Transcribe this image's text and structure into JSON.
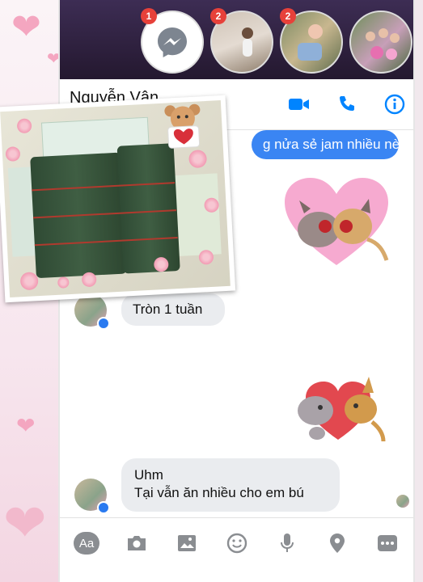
{
  "colors": {
    "messenger_blue": "#3a85f3",
    "badge_red": "#e7413a",
    "incoming_bubble": "#eaecef",
    "icon_gray": "#8a8d91",
    "heart_pink": "#f4a6c0"
  },
  "chat_heads": [
    {
      "name": "messenger-chathead",
      "badge": "1",
      "icon": "messenger-bolt-icon"
    },
    {
      "name": "contact-chathead-1",
      "badge": "2"
    },
    {
      "name": "contact-chathead-2",
      "badge": "2"
    },
    {
      "name": "contact-chathead-3",
      "badge": ""
    }
  ],
  "header": {
    "contact_name": "Nguyễn Vân",
    "icons": [
      "video-call-icon",
      "phone-call-icon",
      "info-icon"
    ]
  },
  "messages": {
    "outgoing_1": "g nửa sẻ jam nhiều nè",
    "incoming_1": "Tròn 1 tuần",
    "incoming_2_line1": "Uhm",
    "incoming_2_line2": "Tại vẫn ăn nhiều cho em bú"
  },
  "stickers": [
    "kissing-cats-sticker",
    "hugging-cats-sticker"
  ],
  "composer": {
    "aa_label": "Aa",
    "icons": [
      "text-format-icon",
      "camera-icon",
      "gallery-icon",
      "emoji-icon",
      "microphone-icon",
      "location-icon",
      "more-icon"
    ]
  },
  "overlay_photo": {
    "icon": "money-stacks-photo",
    "teddy_icon": "teddy-bear-heart-icon"
  }
}
